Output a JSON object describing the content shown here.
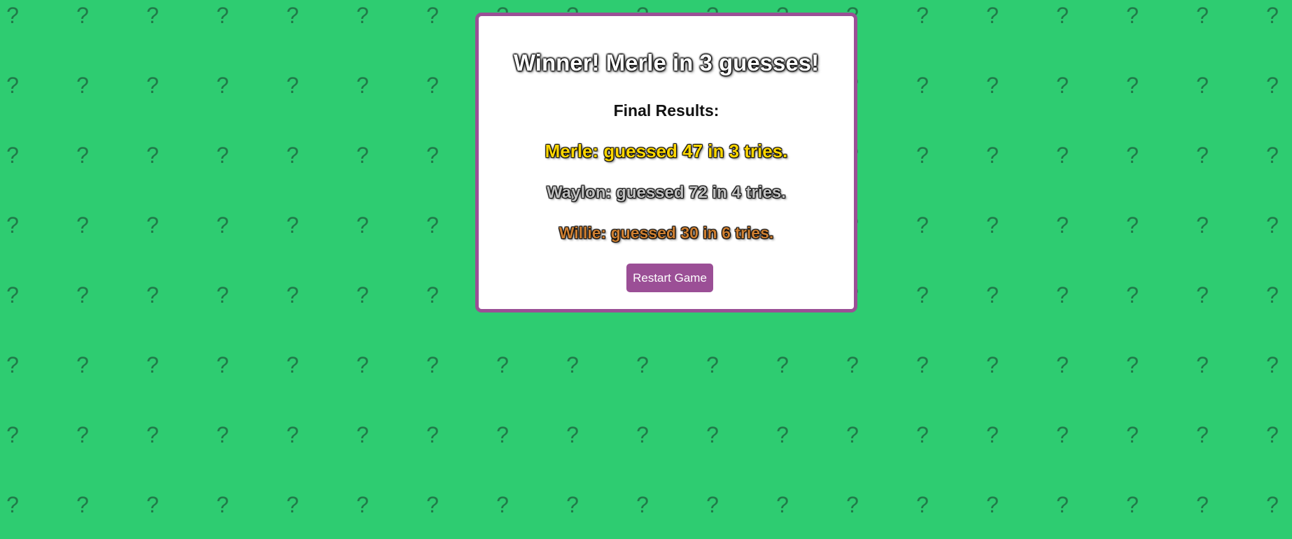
{
  "background": {
    "color": "#2ecc71",
    "pattern_glyph": "?",
    "pattern_icon": "question-mark-icon"
  },
  "modal": {
    "border_color": "#9b4f96",
    "title": "Winner! Merle in 3 guesses!",
    "final_label": "Final Results:",
    "results": [
      {
        "text": "Merle: guessed 47 in 3 tries.",
        "color": "#ffd700"
      },
      {
        "text": "Waylon: guessed 72 in 4 tries.",
        "color": "#c0c0c0"
      },
      {
        "text": "Willie: guessed 30 in 6 tries.",
        "color": "#cd7f32"
      }
    ],
    "restart_label": "Restart Game"
  }
}
